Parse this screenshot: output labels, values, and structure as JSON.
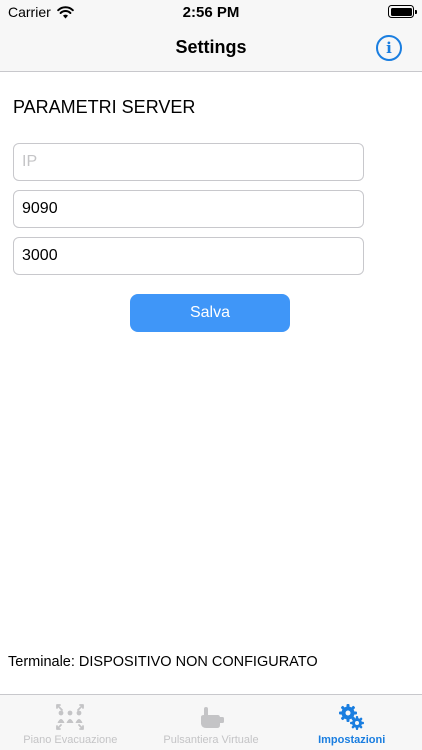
{
  "status_bar": {
    "carrier": "Carrier",
    "time": "2:56 PM"
  },
  "nav": {
    "title": "Settings",
    "info_icon": "info-icon"
  },
  "section": {
    "title": "PARAMETRI SERVER"
  },
  "fields": {
    "ip": {
      "value": "",
      "placeholder": "IP"
    },
    "port_1": {
      "value": "9090"
    },
    "port_2": {
      "value": "3000"
    }
  },
  "actions": {
    "save_label": "Salva"
  },
  "terminal": {
    "text": "Terminale: DISPOSITIVO NON CONFIGURATO"
  },
  "tabs": [
    {
      "label": "Piano Evacuazione",
      "icon": "evacuation-icon",
      "active": false
    },
    {
      "label": "Pulsantiera Virtuale",
      "icon": "hand-press-icon",
      "active": false
    },
    {
      "label": "Impostazioni",
      "icon": "gears-icon",
      "active": true
    }
  ],
  "colors": {
    "accent": "#1a7ee0",
    "button": "#3f96f8",
    "inactive": "#c4c4c6"
  }
}
